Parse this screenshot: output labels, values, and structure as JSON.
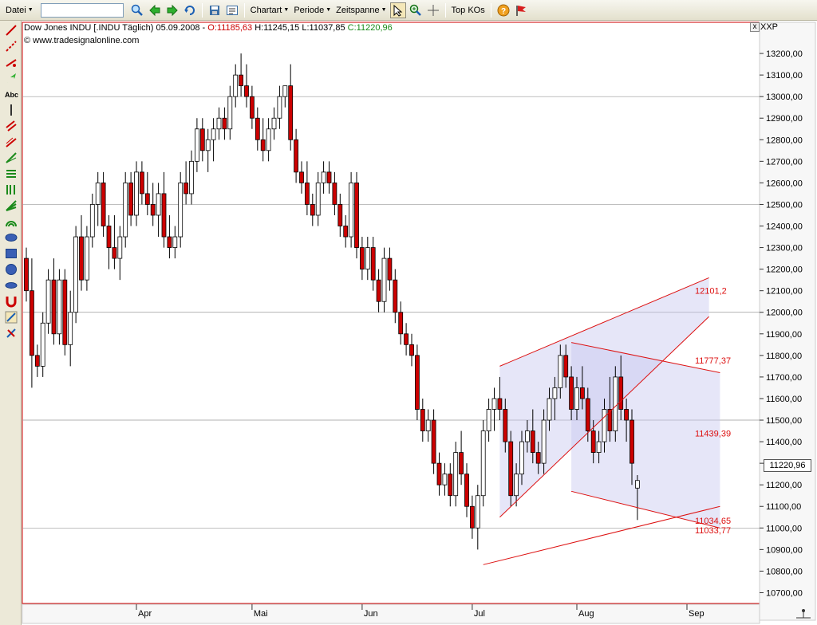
{
  "toolbar": {
    "datei": "Datei",
    "search_value": "",
    "chartart": "Chartart",
    "periode": "Periode",
    "zeitspanne": "Zeitspanne",
    "topkos": "Top KOs"
  },
  "header": {
    "title": "Dow Jones INDU [.INDU  Täglich) 05.09.2008 -",
    "open": "O:11185,63",
    "high": "H:11245,15",
    "low": "L:11037,85",
    "close": "C:11220,96",
    "source": "© www.tradesignalonline.com",
    "symbol": "XXP",
    "close_btn": "x"
  },
  "price_tag": "11220,96",
  "colors": {
    "up": "#ffffff",
    "down": "#cc0000",
    "wick": "#000000",
    "trend": "#dd1111",
    "label": "#dd1111",
    "fill": "#c8c8f0"
  },
  "chart_data": {
    "type": "candlestick",
    "ylim": [
      10650,
      13300
    ],
    "y_ticks": [
      10700,
      10800,
      10900,
      11000,
      11100,
      11200,
      11300,
      11400,
      11500,
      11600,
      11700,
      11800,
      11900,
      12000,
      12100,
      12200,
      12300,
      12400,
      12500,
      12600,
      12700,
      12800,
      12900,
      13000,
      13100,
      13200
    ],
    "y_tick_labels": [
      "10700,00",
      "10800,00",
      "10900,00",
      "11000,00",
      "11100,00",
      "11200,00",
      "11300,00",
      "11400,00",
      "11500,00",
      "11600,00",
      "11700,00",
      "11800,00",
      "11900,00",
      "12000,00",
      "12100,00",
      "12200,00",
      "12300,00",
      "12400,00",
      "12500,00",
      "12600,00",
      "12700,00",
      "12800,00",
      "12900,00",
      "13000,00",
      "13100,00",
      "13200,00"
    ],
    "h_lines": [
      11000,
      11500,
      12000,
      12500,
      13000
    ],
    "x_labels": [
      {
        "label": "Apr",
        "index": 20
      },
      {
        "label": "Mai",
        "index": 41
      },
      {
        "label": "Jun",
        "index": 61
      },
      {
        "label": "Jul",
        "index": 81
      },
      {
        "label": "Aug",
        "index": 100
      },
      {
        "label": "Sep",
        "index": 120
      }
    ],
    "candles": [
      [
        12250,
        12300,
        12050,
        12100
      ],
      [
        12100,
        12250,
        11650,
        11800
      ],
      [
        11800,
        11850,
        11700,
        11750
      ],
      [
        11750,
        12000,
        11700,
        11950
      ],
      [
        11950,
        12200,
        11900,
        12150
      ],
      [
        12150,
        12250,
        11850,
        11900
      ],
      [
        11900,
        12200,
        11850,
        12150
      ],
      [
        12150,
        12200,
        11800,
        11850
      ],
      [
        11850,
        12100,
        11750,
        12000
      ],
      [
        12000,
        12400,
        11950,
        12350
      ],
      [
        12350,
        12450,
        12100,
        12150
      ],
      [
        12150,
        12400,
        12100,
        12350
      ],
      [
        12350,
        12550,
        12300,
        12500
      ],
      [
        12500,
        12650,
        12400,
        12600
      ],
      [
        12600,
        12650,
        12350,
        12400
      ],
      [
        12400,
        12450,
        12200,
        12300
      ],
      [
        12300,
        12450,
        12200,
        12250
      ],
      [
        12250,
        12400,
        12150,
        12350
      ],
      [
        12350,
        12650,
        12300,
        12600
      ],
      [
        12600,
        12650,
        12400,
        12450
      ],
      [
        12450,
        12700,
        12400,
        12650
      ],
      [
        12650,
        12700,
        12500,
        12550
      ],
      [
        12550,
        12650,
        12450,
        12500
      ],
      [
        12500,
        12600,
        12400,
        12450
      ],
      [
        12450,
        12600,
        12350,
        12550
      ],
      [
        12550,
        12650,
        12300,
        12350
      ],
      [
        12350,
        12450,
        12250,
        12300
      ],
      [
        12300,
        12400,
        12250,
        12350
      ],
      [
        12350,
        12650,
        12300,
        12600
      ],
      [
        12600,
        12700,
        12500,
        12550
      ],
      [
        12550,
        12750,
        12500,
        12700
      ],
      [
        12700,
        12900,
        12650,
        12850
      ],
      [
        12850,
        12900,
        12700,
        12750
      ],
      [
        12750,
        12850,
        12650,
        12800
      ],
      [
        12800,
        12900,
        12700,
        12850
      ],
      [
        12850,
        12950,
        12800,
        12900
      ],
      [
        12900,
        12950,
        12800,
        12850
      ],
      [
        12850,
        13050,
        12800,
        13000
      ],
      [
        13000,
        13150,
        12950,
        13100
      ],
      [
        13100,
        13200,
        13000,
        13050
      ],
      [
        13050,
        13150,
        12950,
        13000
      ],
      [
        13000,
        13050,
        12850,
        12900
      ],
      [
        12900,
        12950,
        12750,
        12800
      ],
      [
        12800,
        12900,
        12700,
        12750
      ],
      [
        12750,
        12900,
        12700,
        12850
      ],
      [
        12850,
        12950,
        12800,
        12900
      ],
      [
        12900,
        13050,
        12850,
        13000
      ],
      [
        13000,
        13050,
        12950,
        13050
      ],
      [
        13050,
        13150,
        12750,
        12800
      ],
      [
        12800,
        12850,
        12600,
        12650
      ],
      [
        12650,
        12700,
        12550,
        12600
      ],
      [
        12600,
        12700,
        12450,
        12500
      ],
      [
        12500,
        12550,
        12400,
        12450
      ],
      [
        12450,
        12650,
        12400,
        12600
      ],
      [
        12600,
        12700,
        12550,
        12650
      ],
      [
        12650,
        12700,
        12550,
        12600
      ],
      [
        12600,
        12650,
        12450,
        12500
      ],
      [
        12500,
        12550,
        12350,
        12400
      ],
      [
        12400,
        12450,
        12300,
        12350
      ],
      [
        12350,
        12650,
        12300,
        12600
      ],
      [
        12600,
        12650,
        12250,
        12300
      ],
      [
        12300,
        12350,
        12150,
        12200
      ],
      [
        12200,
        12350,
        12150,
        12300
      ],
      [
        12300,
        12350,
        12100,
        12150
      ],
      [
        12150,
        12200,
        12000,
        12050
      ],
      [
        12050,
        12300,
        12000,
        12250
      ],
      [
        12250,
        12300,
        12100,
        12150
      ],
      [
        12150,
        12200,
        11950,
        12000
      ],
      [
        12000,
        12050,
        11850,
        11900
      ],
      [
        11900,
        11950,
        11800,
        11850
      ],
      [
        11850,
        11900,
        11750,
        11800
      ],
      [
        11800,
        11850,
        11500,
        11550
      ],
      [
        11550,
        11600,
        11400,
        11450
      ],
      [
        11450,
        11550,
        11400,
        11500
      ],
      [
        11500,
        11550,
        11250,
        11300
      ],
      [
        11300,
        11350,
        11150,
        11200
      ],
      [
        11200,
        11300,
        11150,
        11250
      ],
      [
        11250,
        11300,
        11100,
        11150
      ],
      [
        11150,
        11400,
        11100,
        11350
      ],
      [
        11350,
        11450,
        11200,
        11250
      ],
      [
        11250,
        11300,
        11050,
        11100
      ],
      [
        11100,
        11150,
        10950,
        11000
      ],
      [
        11000,
        11200,
        10900,
        11150
      ],
      [
        11150,
        11500,
        11100,
        11450
      ],
      [
        11450,
        11600,
        11400,
        11550
      ],
      [
        11550,
        11650,
        11450,
        11600
      ],
      [
        11600,
        11700,
        11500,
        11550
      ],
      [
        11550,
        11600,
        11350,
        11400
      ],
      [
        11400,
        11450,
        11100,
        11150
      ],
      [
        11150,
        11300,
        11100,
        11250
      ],
      [
        11250,
        11450,
        11200,
        11400
      ],
      [
        11400,
        11500,
        11350,
        11450
      ],
      [
        11450,
        11550,
        11300,
        11350
      ],
      [
        11350,
        11400,
        11250,
        11300
      ],
      [
        11300,
        11550,
        11250,
        11500
      ],
      [
        11500,
        11650,
        11450,
        11600
      ],
      [
        11600,
        11700,
        11500,
        11650
      ],
      [
        11650,
        11850,
        11600,
        11800
      ],
      [
        11800,
        11850,
        11650,
        11700
      ],
      [
        11700,
        11750,
        11500,
        11550
      ],
      [
        11550,
        11700,
        11500,
        11650
      ],
      [
        11650,
        11750,
        11550,
        11600
      ],
      [
        11600,
        11650,
        11400,
        11450
      ],
      [
        11450,
        11500,
        11300,
        11350
      ],
      [
        11350,
        11450,
        11300,
        11400
      ],
      [
        11400,
        11600,
        11350,
        11550
      ],
      [
        11550,
        11700,
        11400,
        11450
      ],
      [
        11450,
        11750,
        11400,
        11700
      ],
      [
        11700,
        11800,
        11500,
        11550
      ],
      [
        11550,
        11600,
        11400,
        11500
      ],
      [
        11500,
        11550,
        11200,
        11300
      ],
      [
        11185,
        11245,
        11037,
        11220
      ]
    ],
    "trendlines": [
      {
        "from": [
          86,
          11050
        ],
        "to": [
          124,
          11980
        ]
      },
      {
        "from": [
          86,
          11750
        ],
        "to": [
          124,
          12160
        ]
      },
      {
        "from": [
          99,
          11860
        ],
        "to": [
          126,
          11720
        ]
      },
      {
        "from": [
          99,
          11170
        ],
        "to": [
          126,
          11000
        ]
      },
      {
        "from": [
          83,
          10830
        ],
        "to": [
          126,
          11100
        ]
      }
    ],
    "annotations": [
      {
        "text": "12101,2",
        "value": 12101
      },
      {
        "text": "11777,37",
        "value": 11777
      },
      {
        "text": "11439,39",
        "value": 11439
      },
      {
        "text": "11034,65",
        "value": 11034
      },
      {
        "text": "11033,77",
        "value": 10990
      }
    ]
  }
}
